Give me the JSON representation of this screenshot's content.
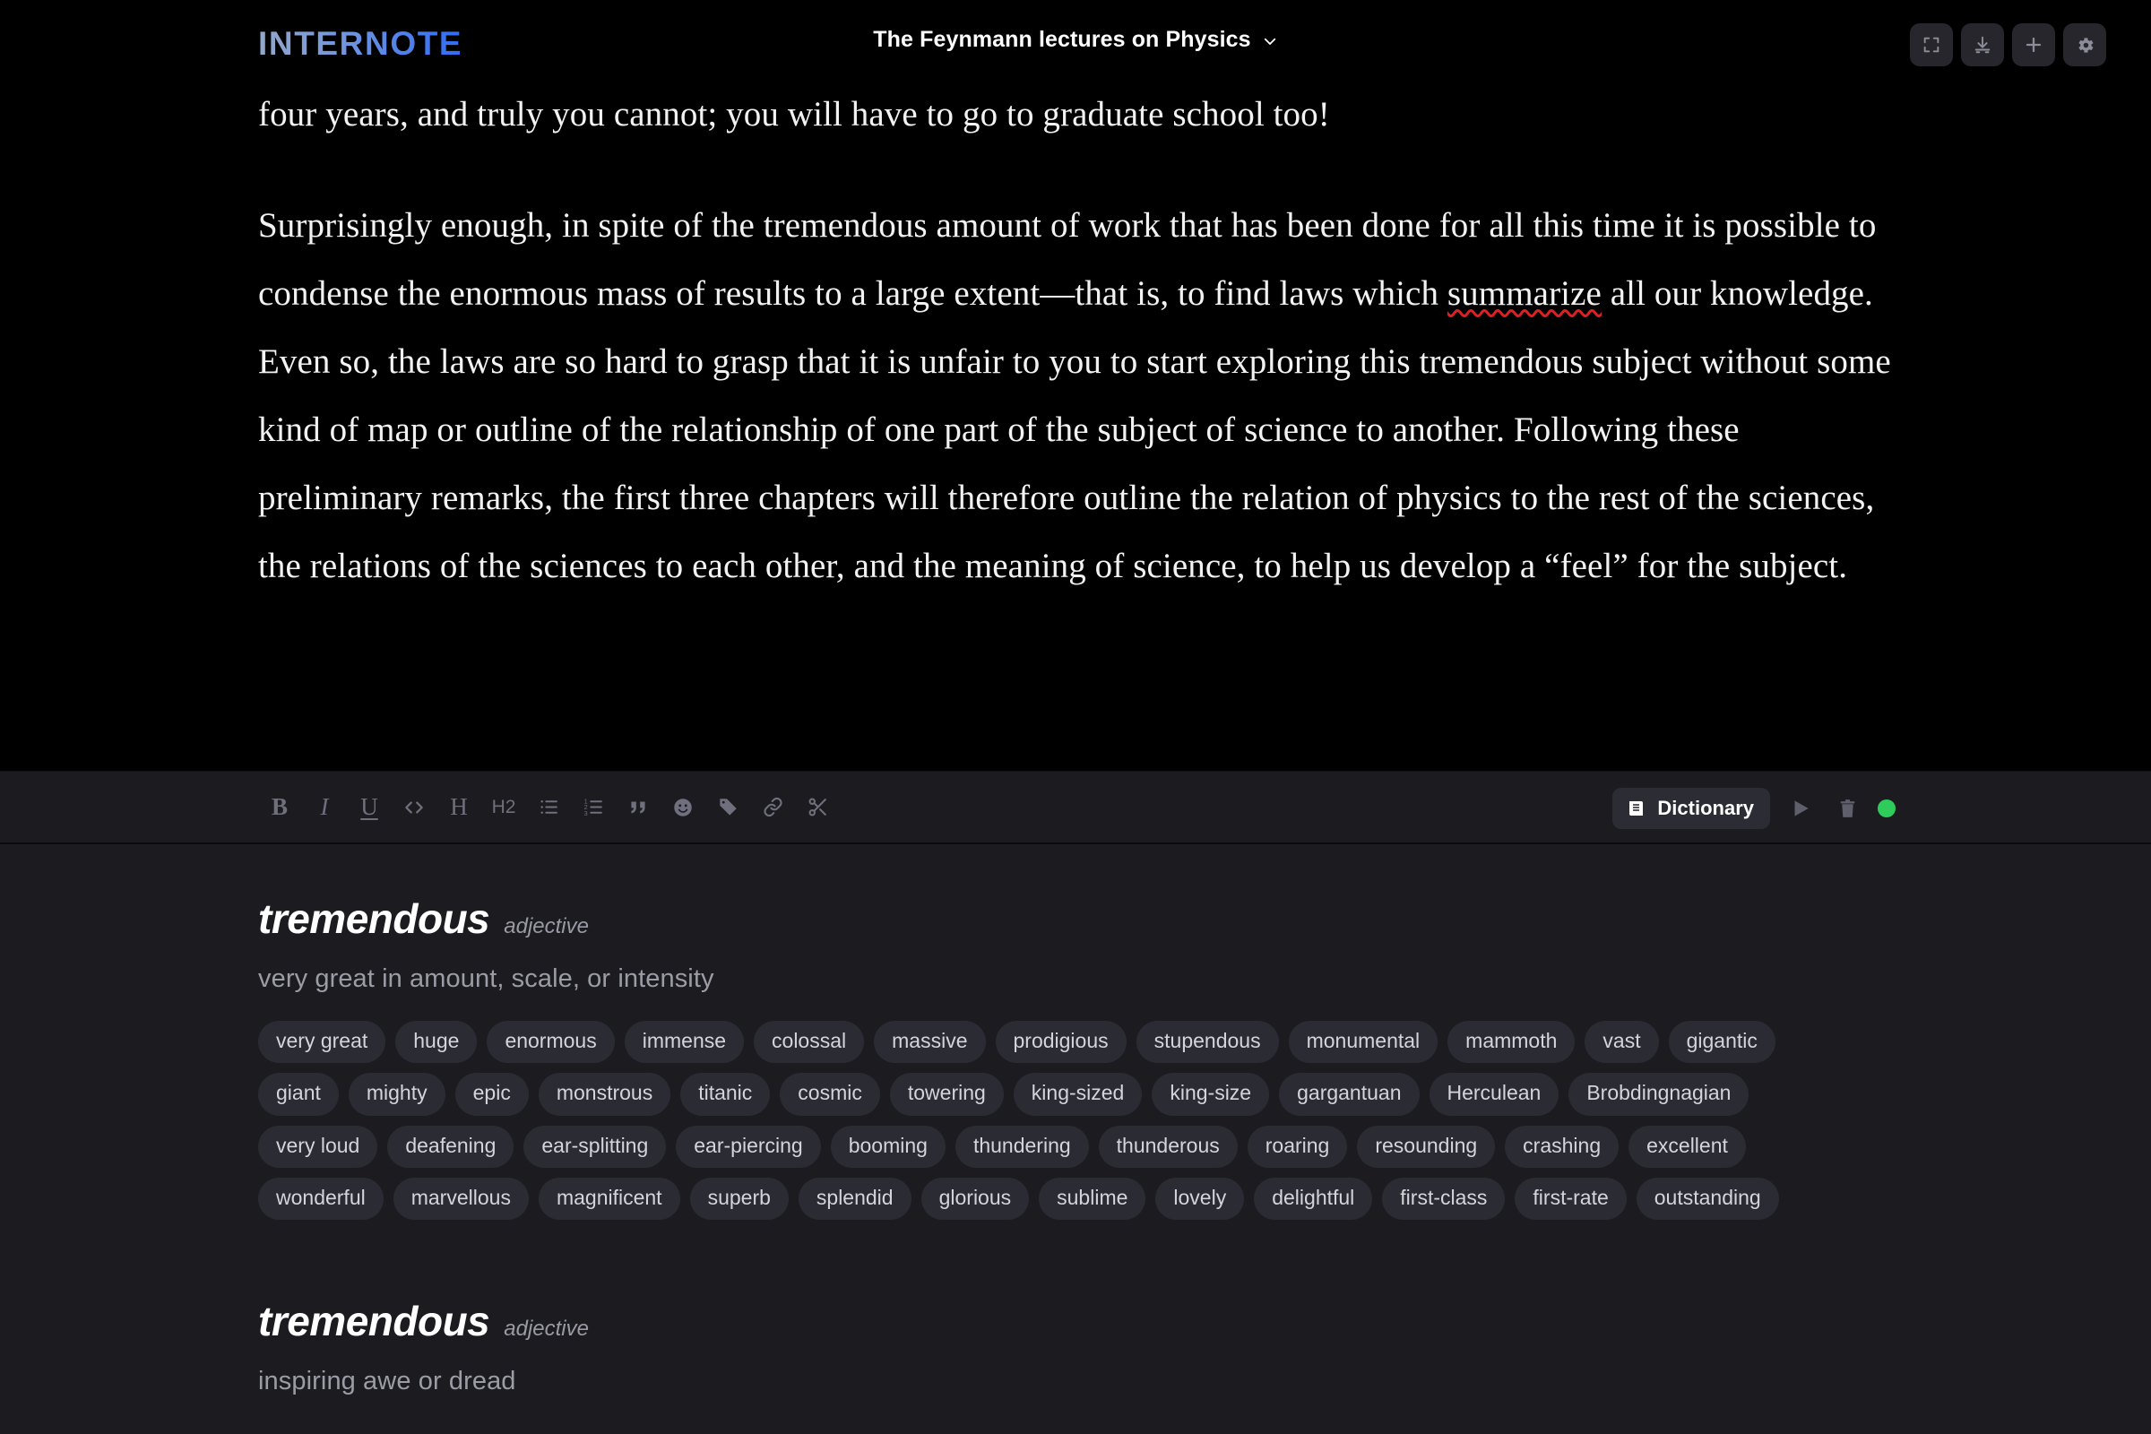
{
  "header": {
    "logo": "INTERNOTE",
    "doc_title": "The Feynmann lectures on Physics",
    "chevron_icon": "chevron-down-icon",
    "actions": [
      {
        "name": "fullscreen-button",
        "icon": "fullscreen-icon"
      },
      {
        "name": "download-button",
        "icon": "download-icon"
      },
      {
        "name": "add-button",
        "icon": "plus-icon"
      },
      {
        "name": "settings-button",
        "icon": "gear-icon"
      }
    ]
  },
  "editor": {
    "paragraph_1": "four years, and truly you cannot; you will have to go to graduate school too!",
    "paragraph_2_a": "Surprisingly enough, in spite of the tremendous amount of work that has been done for all this time it is possible to condense the enormous mass of results to a large extent—that is, to find laws which ",
    "paragraph_2_misspelled": "summarize",
    "paragraph_2_b": " all our knowledge. Even so, the laws are so hard to grasp that it is unfair to you to start exploring this tremendous subject without some kind of map or outline of the relationship of one part of the subject of science to another. Following these preliminary remarks, the first three chapters will therefore outline the relation of physics to the rest of the sciences, the relations of the sciences to each other, and the meaning of science, to help us develop a “feel” for the subject."
  },
  "toolbar": {
    "tools": [
      {
        "name": "bold-button",
        "glyph": "B",
        "style": "bo"
      },
      {
        "name": "italic-button",
        "glyph": "I",
        "style": "it"
      },
      {
        "name": "underline-button",
        "glyph": "U",
        "style": "un"
      },
      {
        "name": "code-button",
        "glyph": "</>",
        "style": "code"
      },
      {
        "name": "heading-button",
        "glyph": "H",
        "style": "plain"
      },
      {
        "name": "heading-2-button",
        "glyph": "H2",
        "style": "h2"
      },
      {
        "name": "bulleted-list-button",
        "glyph": "bullet-list-icon",
        "style": "svg"
      },
      {
        "name": "numbered-list-button",
        "glyph": "numbered-list-icon",
        "style": "svg"
      },
      {
        "name": "blockquote-button",
        "glyph": "quote-icon",
        "style": "svg"
      },
      {
        "name": "emoji-button",
        "glyph": "emoji-icon",
        "style": "svg"
      },
      {
        "name": "tag-button",
        "glyph": "tag-icon",
        "style": "svg"
      },
      {
        "name": "link-button",
        "glyph": "link-icon",
        "style": "svg"
      },
      {
        "name": "cut-button",
        "glyph": "scissors-icon",
        "style": "svg"
      }
    ],
    "dictionary_label": "Dictionary",
    "dictionary_icon": "book-icon",
    "play_icon": "play-icon",
    "delete_icon": "trash-icon",
    "status_dot_color": "#2ecc5a"
  },
  "dictionary": {
    "entries": [
      {
        "word": "tremendous",
        "pos": "adjective",
        "definition": "very great in amount, scale, or intensity",
        "tag_rows": [
          [
            "very great",
            "huge",
            "enormous",
            "immense",
            "colossal",
            "massive",
            "prodigious",
            "stupendous",
            "monumental",
            "mammoth",
            "vast",
            "gigantic"
          ],
          [
            "giant",
            "mighty",
            "epic",
            "monstrous",
            "titanic",
            "cosmic",
            "towering",
            "king-sized",
            "king-size",
            "gargantuan",
            "Herculean",
            "Brobdingnagian"
          ],
          [
            "very loud",
            "deafening",
            "ear-splitting",
            "ear-piercing",
            "booming",
            "thundering",
            "thunderous",
            "roaring",
            "resounding",
            "crashing",
            "excellent"
          ],
          [
            "wonderful",
            "marvellous",
            "magnificent",
            "superb",
            "splendid",
            "glorious",
            "sublime",
            "lovely",
            "delightful",
            "first-class",
            "first-rate",
            "outstanding"
          ]
        ]
      },
      {
        "word": "tremendous",
        "pos": "adjective",
        "definition": "inspiring awe or dread",
        "tag_rows": []
      }
    ]
  },
  "colors": {
    "editor_bg": "#000000",
    "panel_bg": "#1b1b20",
    "tag_bg": "#2b2b33",
    "accent_blue": "#2f6bf5",
    "status_green": "#2ecc5a",
    "spellcheck_red": "#e02020"
  }
}
